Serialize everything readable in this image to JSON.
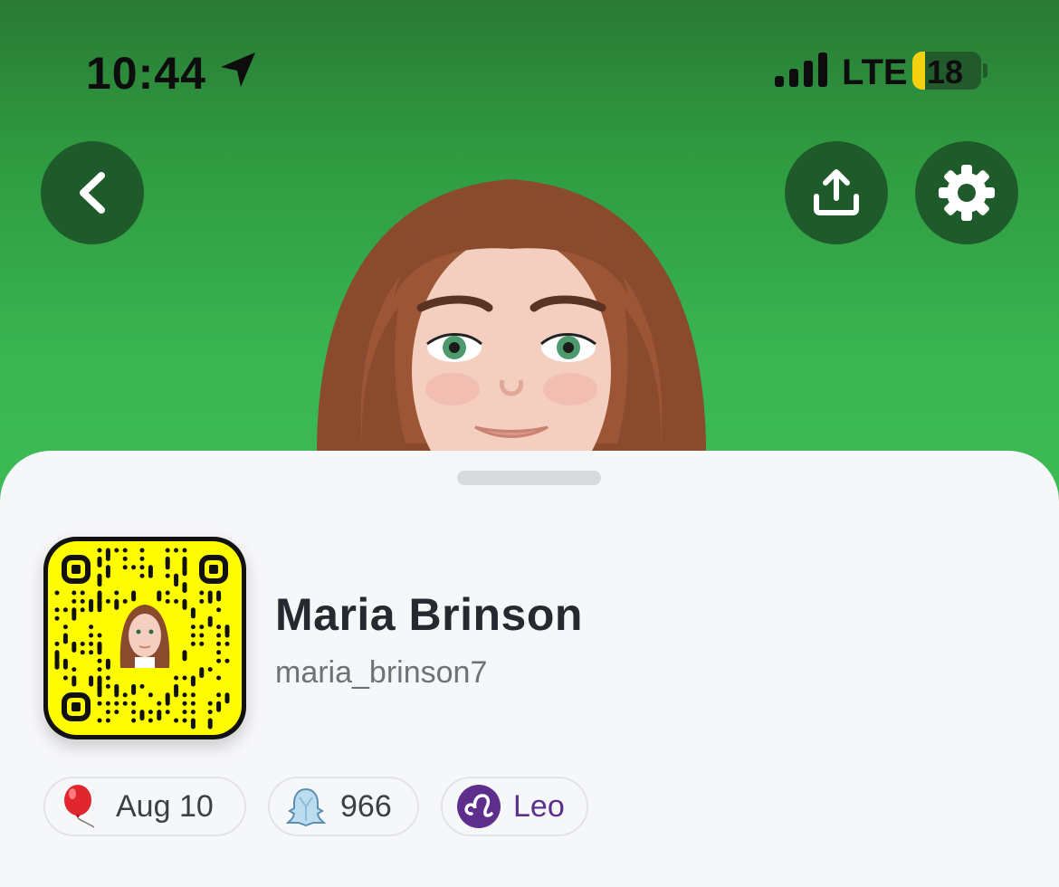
{
  "status_bar": {
    "time": "10:44",
    "network": "LTE",
    "battery": "18",
    "battery_level": 0.18
  },
  "header": {
    "back_icon": "chevron-left-icon",
    "share_icon": "share-upload-icon",
    "settings_icon": "gear-icon"
  },
  "colors": {
    "hero_green": "#3cbb55",
    "snapcode_yellow": "#fffc00",
    "zodiac_purple": "#5d2e8c",
    "battery_yellow": "#f5d20f"
  },
  "profile": {
    "display_name": "Maria Brinson",
    "username": "maria_brinson7"
  },
  "chips": [
    {
      "icon": "balloon-icon",
      "label": "Aug 10"
    },
    {
      "icon": "snap-score-ghost-icon",
      "label": "966"
    },
    {
      "icon": "leo-zodiac-icon",
      "label": "Leo"
    }
  ]
}
